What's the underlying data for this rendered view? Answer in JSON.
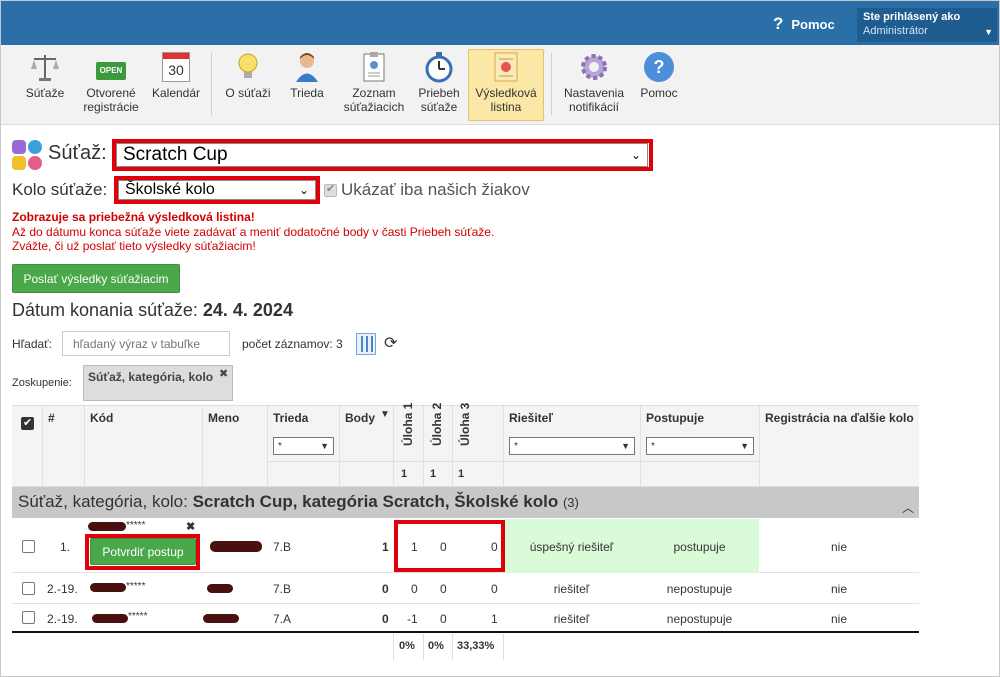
{
  "header": {
    "help_label": "Pomoc",
    "help_icon": "question-icon",
    "user_line1": "Ste prihlásený ako",
    "user_line2": "Administrátor"
  },
  "toolbar": [
    {
      "name": "sutaze",
      "label1": "Súťaže",
      "label2": "",
      "icon": "scales-icon"
    },
    {
      "name": "otvorene-registracie",
      "label1": "Otvorené",
      "label2": "registrácie",
      "icon": "open-sign-icon",
      "icon_text": "OPEN"
    },
    {
      "name": "kalendar",
      "label1": "Kalendár",
      "label2": "",
      "icon": "calendar-icon",
      "icon_text": "30"
    },
    {
      "name": "o-sutazi",
      "label1": "O súťaži",
      "label2": "",
      "icon": "lightbulb-icon"
    },
    {
      "name": "trieda",
      "label1": "Trieda",
      "label2": "",
      "icon": "person-icon"
    },
    {
      "name": "zoznam-sutaziacich",
      "label1": "Zoznam",
      "label2": "súťažiacich",
      "icon": "clipboard-icon"
    },
    {
      "name": "priebeh-sutaze",
      "label1": "Priebeh",
      "label2": "súťaže",
      "icon": "stopwatch-icon"
    },
    {
      "name": "vysledkova-listina",
      "label1": "Výsledková",
      "label2": "listina",
      "icon": "certificate-icon"
    },
    {
      "name": "nastavenia-notifikacii",
      "label1": "Nastavenia",
      "label2": "notifikácií",
      "icon": "gear-icon"
    },
    {
      "name": "pomoc",
      "label1": "Pomoc",
      "label2": "",
      "icon": "help-circle-icon",
      "icon_text": "?"
    }
  ],
  "competition": {
    "label": "Súťaž:",
    "value": "Scratch Cup"
  },
  "round": {
    "label": "Kolo súťaže:",
    "value": "Školské kolo",
    "only_ours_label": "Ukázať iba našich žiakov"
  },
  "warning": {
    "line1": "Zobrazuje sa priebežná výsledková listina!",
    "line2": "Až do dátumu konca súťaže viete zadávať a meniť dodatočné body v časti Priebeh súťaže.",
    "line3": "Zvážte, či už poslať tieto výsledky súťažiacim!"
  },
  "send_button": "Poslať výsledky súťažiacim",
  "date": {
    "label": "Dátum konania súťaže:",
    "value": "24. 4. 2024"
  },
  "search": {
    "label": "Hľadať:",
    "placeholder": "hľadaný výraz v tabuľke",
    "count_label": "počet záznamov: 3"
  },
  "grouping": {
    "label": "Zoskupenie:",
    "tag": "Súťaž, kategória, kolo",
    "remove": "✖"
  },
  "table": {
    "headers": {
      "num": "#",
      "code": "Kód",
      "name": "Meno",
      "class": "Trieda",
      "points": "Body",
      "u1": "Úloha 1",
      "u2": "Úloha 2",
      "u3": "Úloha 3",
      "solver": "Riešiteľ",
      "advances": "Postupuje",
      "registration": "Registrácia na ďalšie kolo"
    },
    "filter_value": "*",
    "max_points": [
      "1",
      "1",
      "1"
    ],
    "group_prefix": "Súťaž, kategória, kolo: ",
    "group_name": "Scratch Cup, kategória Scratch, Školské kolo",
    "group_count": "(3)",
    "rows": [
      {
        "rank": "1.",
        "code_suffix": "*****",
        "class": "7.B",
        "points": "1",
        "u1": "1",
        "u2": "0",
        "u3": "0",
        "solver": "úspešný riešiteľ",
        "advances": "postupuje",
        "registration": "nie",
        "confirm": "Potvrdiť postup"
      },
      {
        "rank": "2.-19.",
        "code_suffix": "*****",
        "class": "7.B",
        "points": "0",
        "u1": "0",
        "u2": "0",
        "u3": "0",
        "solver": "riešiteľ",
        "advances": "nepostupuje",
        "registration": "nie"
      },
      {
        "rank": "2.-19.",
        "code_suffix": "*****",
        "class": "7.A",
        "points": "0",
        "u1": "-1",
        "u2": "0",
        "u3": "1",
        "solver": "riešiteľ",
        "advances": "nepostupuje",
        "registration": "nie"
      }
    ],
    "footer": {
      "u1": "0%",
      "u2": "0%",
      "u3": "33,33%"
    }
  },
  "colors": {
    "topbar": "#2a6fa7",
    "green": "#4aa84a",
    "highlight": "#d9fbd7",
    "red": "#e0000a"
  }
}
